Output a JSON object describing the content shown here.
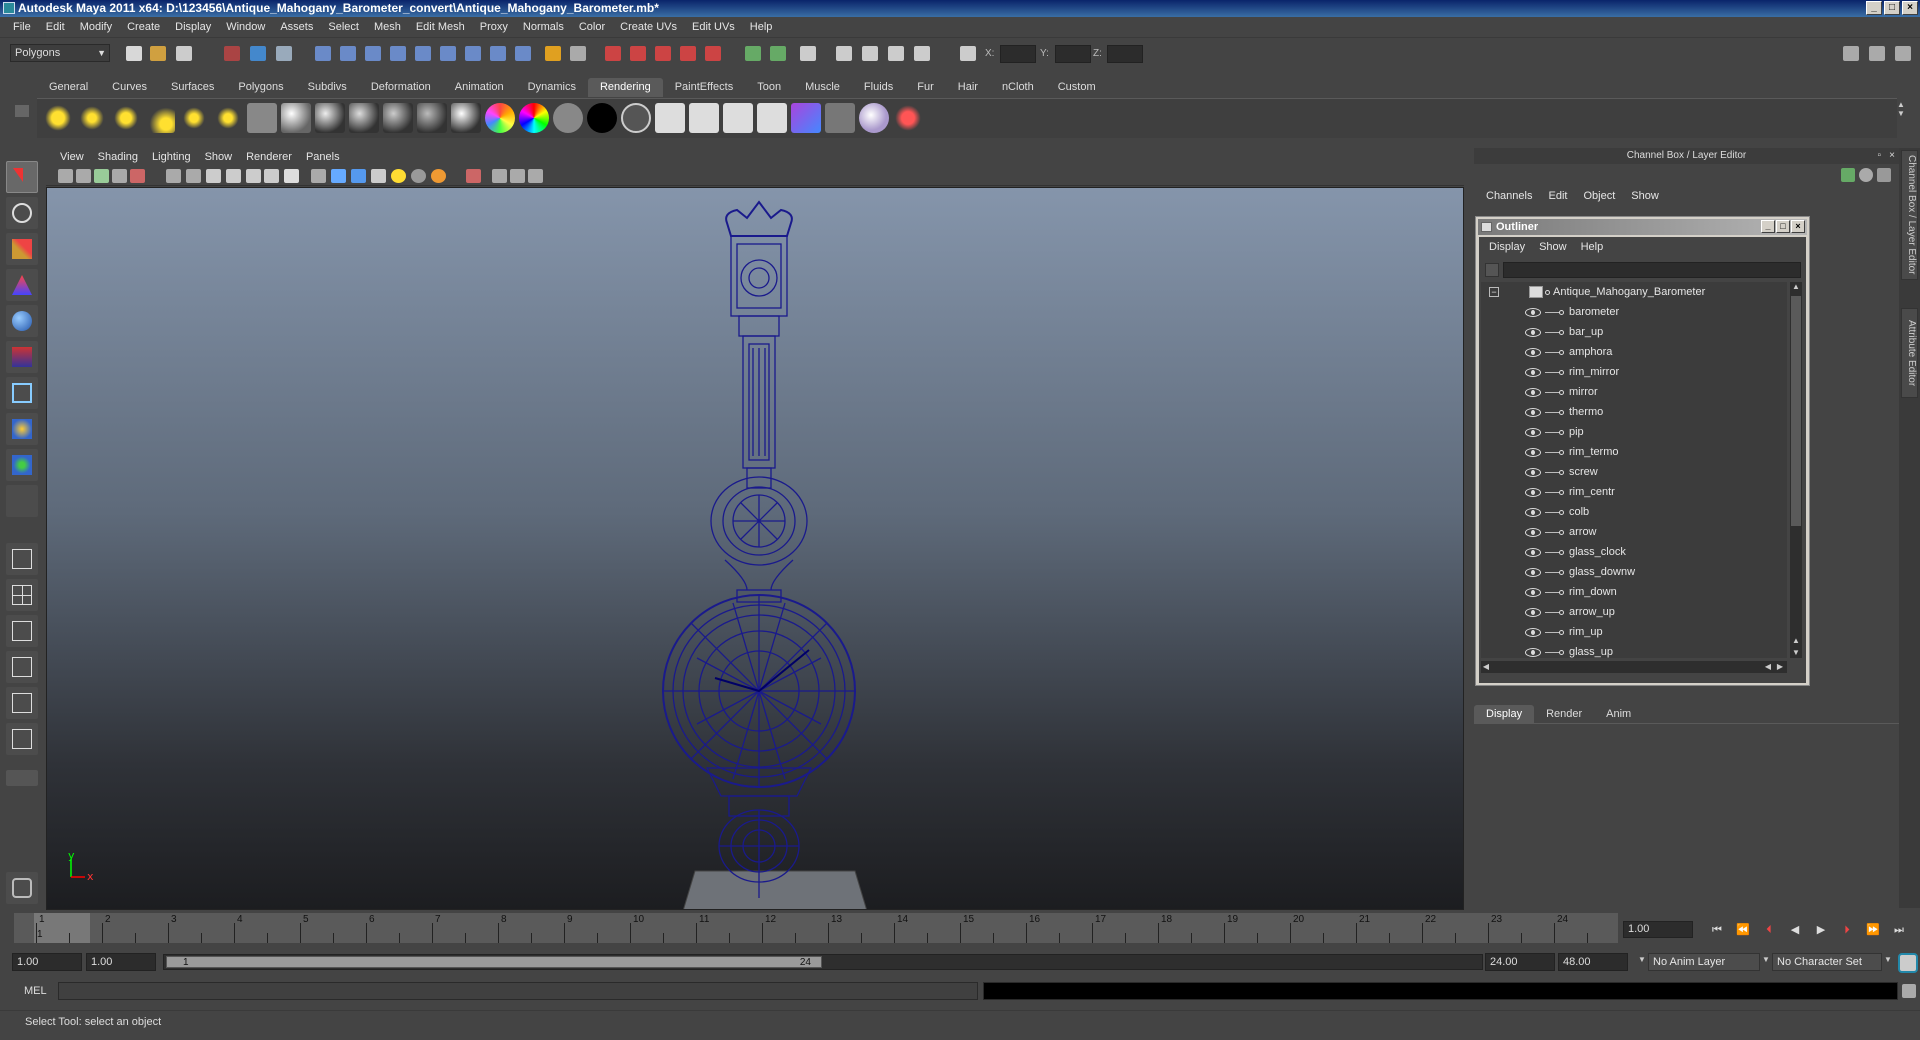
{
  "window": {
    "title": "Autodesk Maya 2011 x64: D:\\123456\\Antique_Mahogany_Barometer_convert\\Antique_Mahogany_Barometer.mb*",
    "controls": [
      "minimize",
      "maximize",
      "close"
    ]
  },
  "menubar": [
    "File",
    "Edit",
    "Modify",
    "Create",
    "Display",
    "Window",
    "Assets",
    "Select",
    "Mesh",
    "Edit Mesh",
    "Proxy",
    "Normals",
    "Color",
    "Create UVs",
    "Edit UVs",
    "Help"
  ],
  "statusline": {
    "mode": "Polygons",
    "x_label": "X:",
    "y_label": "Y:",
    "z_label": "Z:"
  },
  "shelf": {
    "tabs": [
      "General",
      "Curves",
      "Surfaces",
      "Polygons",
      "Subdivs",
      "Deformation",
      "Animation",
      "Dynamics",
      "Rendering",
      "PaintEffects",
      "Toon",
      "Muscle",
      "Fluids",
      "Fur",
      "Hair",
      "nCloth",
      "Custom"
    ],
    "active_tab": "Rendering"
  },
  "viewport": {
    "menu": [
      "View",
      "Shading",
      "Lighting",
      "Show",
      "Renderer",
      "Panels"
    ],
    "axis_x": "x",
    "axis_y": "y",
    "wire_color": "#1a1a8c"
  },
  "channel_box": {
    "header": "Channel Box / Layer Editor",
    "menu": [
      "Channels",
      "Edit",
      "Object",
      "Show"
    ]
  },
  "side_tabs": [
    "Channel Box / Layer Editor",
    "Attribute Editor"
  ],
  "outliner": {
    "title": "Outliner",
    "menu": [
      "Display",
      "Show",
      "Help"
    ],
    "root": "Antique_Mahogany_Barometer",
    "items": [
      "barometer",
      "bar_up",
      "amphora",
      "rim_mirror",
      "mirror",
      "thermo",
      "pip",
      "rim_termo",
      "screw",
      "rim_centr",
      "colb",
      "arrow",
      "glass_clock",
      "glass_downw",
      "rim_down",
      "arrow_up",
      "rim_up",
      "glass_up"
    ]
  },
  "layer_editor": {
    "tabs": [
      "Display",
      "Render",
      "Anim"
    ],
    "active_tab": "Display"
  },
  "timeslider": {
    "frames": [
      "1",
      "2",
      "3",
      "4",
      "5",
      "6",
      "7",
      "8",
      "9",
      "10",
      "11",
      "12",
      "13",
      "14",
      "15",
      "16",
      "17",
      "18",
      "19",
      "20",
      "21",
      "22",
      "23",
      "24"
    ],
    "current_frame_label": "1",
    "current_time": "1.00"
  },
  "range": {
    "start_time": "1.00",
    "playback_start": "1.00",
    "range_min_label": "1",
    "range_max_label": "24",
    "playback_end": "24.00",
    "end_time": "48.00",
    "anim_layer": "No Anim Layer",
    "character_set": "No Character Set"
  },
  "commandline": {
    "label": "MEL"
  },
  "helpline": "Select Tool: select an object"
}
